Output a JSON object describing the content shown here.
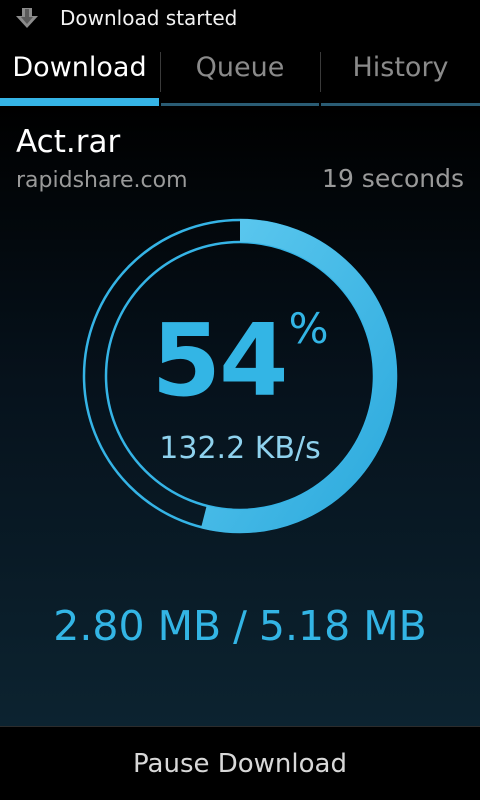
{
  "status_bar": {
    "notification_text": "Download started",
    "icon": "download-arrow-icon"
  },
  "tabs": [
    {
      "label": "Download",
      "selected": true
    },
    {
      "label": "Queue",
      "selected": false
    },
    {
      "label": "History",
      "selected": false
    }
  ],
  "download": {
    "file_name": "Act.rar",
    "host": "rapidshare.com",
    "time_remaining": "19 seconds",
    "percent": "54",
    "percent_sign": "%",
    "progress": 0.54,
    "speed": "132.2 KB/s",
    "downloaded": "2.80 MB",
    "separator": "/",
    "total": "5.18 MB"
  },
  "actions": {
    "pause_label": "Pause Download"
  },
  "colors": {
    "accent": "#33b5e5",
    "background": "#000000",
    "muted_text": "#9a9a9a"
  }
}
